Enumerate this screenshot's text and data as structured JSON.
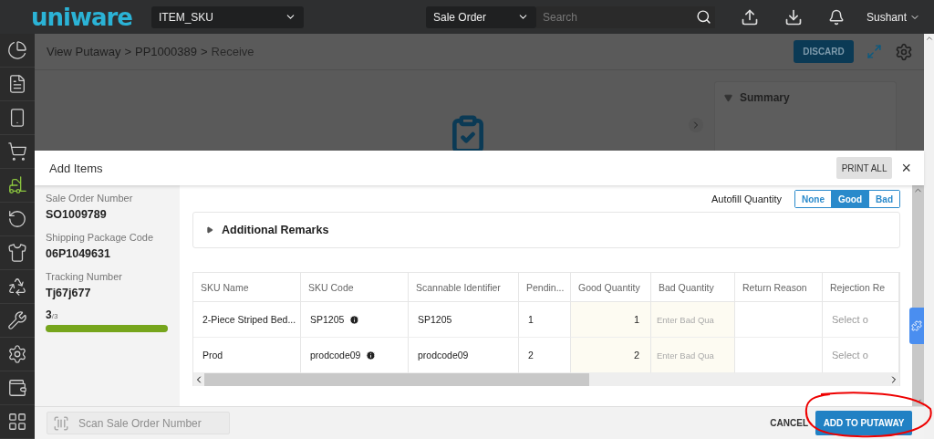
{
  "topbar": {
    "logo": "uniware",
    "sku_select": "ITEM_SKU",
    "search_type": "Sale Order",
    "search": {
      "placeholder": "Search"
    },
    "user": "Sushant"
  },
  "sidebar": {
    "items": [
      {
        "selected": false
      },
      {
        "selected": false
      },
      {
        "selected": false
      },
      {
        "selected": false
      },
      {
        "selected": true
      },
      {
        "selected": false
      },
      {
        "selected": false
      },
      {
        "selected": false
      },
      {
        "selected": false
      },
      {
        "selected": false
      },
      {
        "selected": false
      },
      {
        "selected": false
      }
    ]
  },
  "breadcrumb": [
    "View Putaway",
    "PP1000389",
    "Receive"
  ],
  "breadcrumb_separator": ">",
  "discard_button": "DISCARD",
  "summary": {
    "title": "Summary",
    "expanded": true
  },
  "dialog": {
    "title": "Add Items",
    "print_button": "PRINT ALL",
    "close": "×",
    "fields": [
      {
        "label": "Sale Order Number",
        "value": "SO1009789"
      },
      {
        "label": "Shipping Package Code",
        "value": "06P1049631"
      },
      {
        "label": "Tracking Number",
        "value": "Tj67j677"
      }
    ],
    "progress": {
      "count": "3",
      "total": "/3",
      "level": 1
    },
    "autofill": {
      "label": "Autofill Quantity",
      "options": [
        {
          "label": "None",
          "selected": false
        },
        {
          "label": "Good",
          "selected": true
        },
        {
          "label": "Bad",
          "selected": false
        }
      ]
    },
    "remarks": {
      "title": "Additional Remarks",
      "expanded": false
    },
    "table": {
      "columns": [
        "SKU Name",
        "SKU Code",
        "Scannable Identifier",
        "Pendin...",
        "Good Quantity",
        "Bad Quantity",
        "Return Reason",
        "Rejection Re"
      ],
      "rows": [
        {
          "sku_name": "2-Piece Striped Bed...",
          "sku_code": "SP1205",
          "scannable": "SP1205",
          "pending": "1",
          "good": "1",
          "bad_placeholder": "Enter Bad Qua",
          "rejection_placeholder": "Select o"
        },
        {
          "sku_name": "Prod",
          "sku_code": "prodcode09",
          "scannable": "prodcode09",
          "pending": "2",
          "good": "2",
          "bad_placeholder": "Enter Bad Qua",
          "rejection_placeholder": "Select o"
        }
      ]
    },
    "scan": {
      "placeholder": "Scan Sale Order Number",
      "disabled": true
    },
    "cancel_button": "CANCEL",
    "submit_button": "ADD TO PUTAWAY"
  }
}
